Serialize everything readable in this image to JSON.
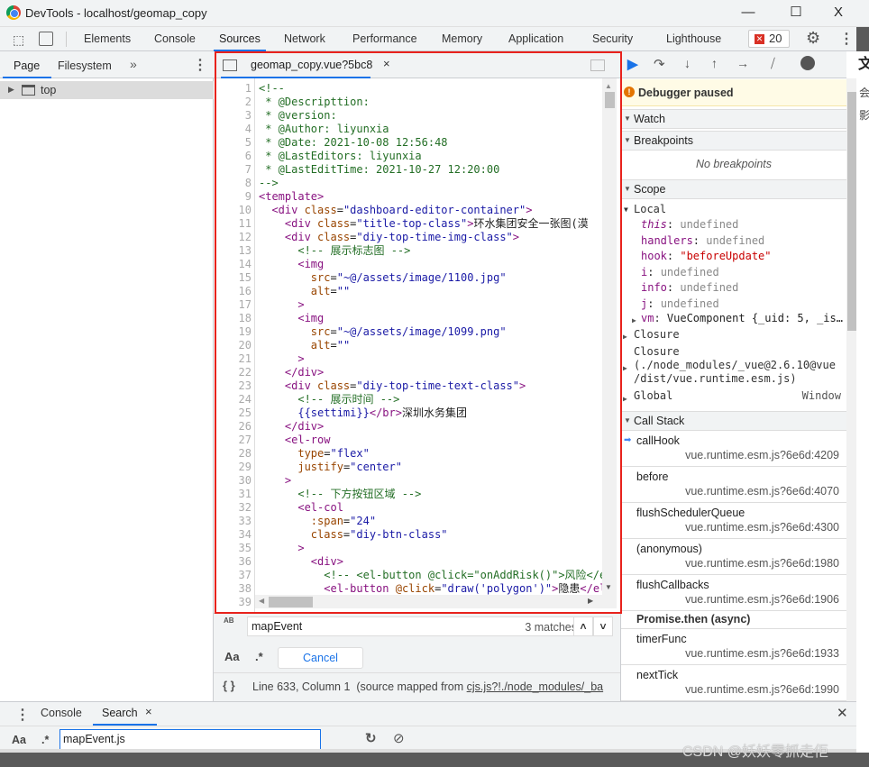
{
  "window": {
    "title": "DevTools - localhost/geomap_copy",
    "minimize": "—",
    "maximize": "☐",
    "close": "X"
  },
  "toolbar": {
    "tabs": [
      "Elements",
      "Console",
      "Sources",
      "Network",
      "Performance",
      "Memory",
      "Application",
      "Security",
      "Lighthouse"
    ],
    "active_tab": "Sources",
    "error_count": "20"
  },
  "navigator": {
    "tabs": [
      "Page",
      "Filesystem"
    ],
    "more": "»",
    "tree": [
      {
        "label": "top"
      }
    ]
  },
  "editor": {
    "file_tab": "geomap_copy.vue?5bc8",
    "lines": [
      [
        [
          "c",
          "<!--"
        ]
      ],
      [
        [
          "c",
          " * @Descripttion:"
        ]
      ],
      [
        [
          "c",
          " * @version:"
        ]
      ],
      [
        [
          "c",
          " * @Author: liyunxia"
        ]
      ],
      [
        [
          "c",
          " * @Date: 2021-10-08 12:56:48"
        ]
      ],
      [
        [
          "c",
          " * @LastEditors: liyunxia"
        ]
      ],
      [
        [
          "c",
          " * @LastEditTime: 2021-10-27 12:20:00"
        ]
      ],
      [
        [
          "c",
          "-->"
        ]
      ],
      [
        [
          "t",
          "<template>"
        ]
      ],
      [
        [
          "x",
          "  "
        ],
        [
          "t",
          "<div "
        ],
        [
          "a",
          "class"
        ],
        [
          "x",
          "="
        ],
        [
          "v",
          "\"dashboard-editor-container\""
        ],
        [
          "t",
          ">"
        ]
      ],
      [
        [
          "x",
          "    "
        ],
        [
          "t",
          "<div "
        ],
        [
          "a",
          "class"
        ],
        [
          "x",
          "="
        ],
        [
          "v",
          "\"title-top-class\""
        ],
        [
          "t",
          ">"
        ],
        [
          "x",
          "环水集团安全一张图(漠"
        ]
      ],
      [
        [
          "x",
          "    "
        ],
        [
          "t",
          "<div "
        ],
        [
          "a",
          "class"
        ],
        [
          "x",
          "="
        ],
        [
          "v",
          "\"diy-top-time-img-class\""
        ],
        [
          "t",
          ">"
        ]
      ],
      [
        [
          "x",
          "      "
        ],
        [
          "c",
          "<!-- 展示标志图 -->"
        ]
      ],
      [
        [
          "x",
          "      "
        ],
        [
          "t",
          "<img"
        ]
      ],
      [
        [
          "x",
          "        "
        ],
        [
          "a",
          "src"
        ],
        [
          "x",
          "="
        ],
        [
          "v",
          "\"~@/assets/image/1100.jpg\""
        ]
      ],
      [
        [
          "x",
          "        "
        ],
        [
          "a",
          "alt"
        ],
        [
          "x",
          "="
        ],
        [
          "v",
          "\"\""
        ]
      ],
      [
        [
          "x",
          "      "
        ],
        [
          "t",
          ">"
        ]
      ],
      [
        [
          "x",
          "      "
        ],
        [
          "t",
          "<img"
        ]
      ],
      [
        [
          "x",
          "        "
        ],
        [
          "a",
          "src"
        ],
        [
          "x",
          "="
        ],
        [
          "v",
          "\"~@/assets/image/1099.png\""
        ]
      ],
      [
        [
          "x",
          "        "
        ],
        [
          "a",
          "alt"
        ],
        [
          "x",
          "="
        ],
        [
          "v",
          "\"\""
        ]
      ],
      [
        [
          "x",
          "      "
        ],
        [
          "t",
          ">"
        ]
      ],
      [
        [
          "x",
          "    "
        ],
        [
          "t",
          "</div>"
        ]
      ],
      [
        [
          "x",
          "    "
        ],
        [
          "t",
          "<div "
        ],
        [
          "a",
          "class"
        ],
        [
          "x",
          "="
        ],
        [
          "v",
          "\"diy-top-time-text-class\""
        ],
        [
          "t",
          ">"
        ]
      ],
      [
        [
          "x",
          "      "
        ],
        [
          "c",
          "<!-- 展示时间 -->"
        ]
      ],
      [
        [
          "x",
          "      "
        ],
        [
          "v",
          "{{settimi}}"
        ],
        [
          "t",
          "</br>"
        ],
        [
          "x",
          "深圳水务集团"
        ]
      ],
      [
        [
          "x",
          "    "
        ],
        [
          "t",
          "</div>"
        ]
      ],
      [
        [
          "x",
          "    "
        ],
        [
          "t",
          "<el-row"
        ]
      ],
      [
        [
          "x",
          "      "
        ],
        [
          "a",
          "type"
        ],
        [
          "x",
          "="
        ],
        [
          "v",
          "\"flex\""
        ]
      ],
      [
        [
          "x",
          "      "
        ],
        [
          "a",
          "justify"
        ],
        [
          "x",
          "="
        ],
        [
          "v",
          "\"center\""
        ]
      ],
      [
        [
          "x",
          "    "
        ],
        [
          "t",
          ">"
        ]
      ],
      [
        [
          "x",
          "      "
        ],
        [
          "c",
          "<!-- 下方按钮区域 -->"
        ]
      ],
      [
        [
          "x",
          "      "
        ],
        [
          "t",
          "<el-col"
        ]
      ],
      [
        [
          "x",
          "        "
        ],
        [
          "a",
          ":span"
        ],
        [
          "x",
          "="
        ],
        [
          "v",
          "\"24\""
        ]
      ],
      [
        [
          "x",
          "        "
        ],
        [
          "a",
          "class"
        ],
        [
          "x",
          "="
        ],
        [
          "v",
          "\"diy-btn-class\""
        ]
      ],
      [
        [
          "x",
          "      "
        ],
        [
          "t",
          ">"
        ]
      ],
      [
        [
          "x",
          "        "
        ],
        [
          "t",
          "<div>"
        ]
      ],
      [
        [
          "x",
          "          "
        ],
        [
          "c",
          "<!-- <el-button @click=\"onAddRisk()\">风险</el"
        ]
      ],
      [
        [
          "x",
          "          "
        ],
        [
          "t",
          "<el-button "
        ],
        [
          "a",
          "@click"
        ],
        [
          "x",
          "="
        ],
        [
          "v",
          "\"draw('polygon')\""
        ],
        [
          "t",
          ">"
        ],
        [
          "x",
          "隐患"
        ],
        [
          "t",
          "</el"
        ]
      ],
      [
        [
          "x",
          ""
        ]
      ]
    ]
  },
  "find": {
    "value": "mapEvent",
    "matches": "3 matches",
    "match_case": "Aa",
    "regex": ".*",
    "cancel": "Cancel",
    "replace_icon": "AB"
  },
  "status": {
    "braces": "{ }",
    "position": "Line 633, Column 1",
    "source_mapped_prefix": "(source mapped from ",
    "source_link": "cjs.js?!./node_modules/_ba"
  },
  "debugger": {
    "paused": "Debugger paused",
    "sections": {
      "watch": "Watch",
      "breakpoints": "Breakpoints",
      "no_breakpoints": "No breakpoints",
      "scope": "Scope",
      "call_stack": "Call Stack"
    },
    "local": "Local",
    "scope_vars": [
      {
        "name": "this",
        "value": "undefined"
      },
      {
        "name": "handlers",
        "value": "undefined"
      },
      {
        "name": "hook",
        "value": "\"beforeUpdate\""
      },
      {
        "name": "i",
        "value": "undefined"
      },
      {
        "name": "info",
        "value": "undefined"
      },
      {
        "name": "j",
        "value": "undefined"
      }
    ],
    "vm": {
      "name": "vm",
      "value": "VueComponent {_uid: 5, _is…"
    },
    "closure1": "Closure",
    "closure2_title": "Closure",
    "closure2_path1": "(./node_modules/_vue@2.6.10@vue",
    "closure2_path2": "/dist/vue.runtime.esm.js)",
    "global": "Global",
    "global_value": "Window",
    "call_stack": [
      {
        "fn": "callHook",
        "loc": "vue.runtime.esm.js?6e6d:4209"
      },
      {
        "fn": "before",
        "loc": "vue.runtime.esm.js?6e6d:4070"
      },
      {
        "fn": "flushSchedulerQueue",
        "loc": "vue.runtime.esm.js?6e6d:4300"
      },
      {
        "fn": "(anonymous)",
        "loc": "vue.runtime.esm.js?6e6d:1980"
      },
      {
        "fn": "flushCallbacks",
        "loc": "vue.runtime.esm.js?6e6d:1906"
      }
    ],
    "async_label": "Promise.then (async)",
    "call_stack_async": [
      {
        "fn": "timerFunc",
        "loc": "vue.runtime.esm.js?6e6d:1933"
      },
      {
        "fn": "nextTick",
        "loc": "vue.runtime.esm.js?6e6d:1990"
      }
    ]
  },
  "drawer": {
    "tabs": [
      "Console",
      "Search"
    ],
    "active": "Search",
    "search_value": "mapEvent.js",
    "match_case": "Aa",
    "regex": ".*"
  },
  "background_text": [
    "文",
    "会",
    "影"
  ],
  "watermark": "CSDN @妖妖零抓走佢",
  "colors": {
    "accent": "#1a73e8",
    "highlight_box": "#e8221c",
    "paused_bg": "#fffbe6"
  }
}
